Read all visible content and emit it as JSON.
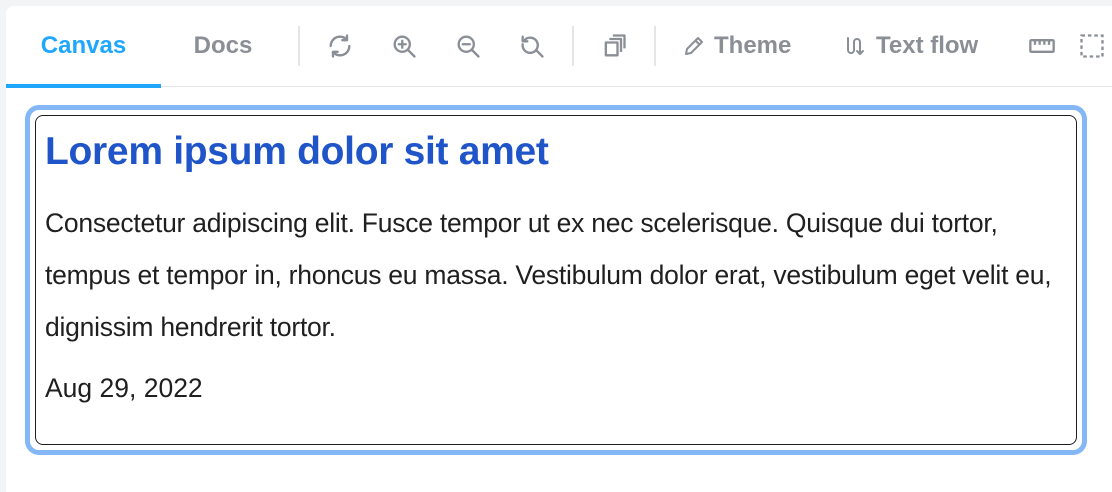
{
  "toolbar": {
    "tabs": [
      {
        "label": "Canvas",
        "active": true
      },
      {
        "label": "Docs",
        "active": false
      }
    ],
    "tools": {
      "remount": "remount-icon",
      "zoom_in": "zoom-in-icon",
      "zoom_out": "zoom-out-icon",
      "zoom_reset": "zoom-reset-icon",
      "backgrounds": "backgrounds-icon"
    },
    "theme_label": "Theme",
    "text_flow_label": "Text flow"
  },
  "card": {
    "title": "Lorem ipsum dolor sit amet",
    "body": "Consectetur adipiscing elit. Fusce tempor ut ex nec scelerisque. Quisque dui tortor, tempus et tempor in, rhoncus eu massa. Vestibulum dolor erat, vestibulum eget velit eu, dignissim hendrerit tortor.",
    "date": "Aug 29, 2022"
  },
  "colors": {
    "accent": "#1ea7fd",
    "title": "#1f55c9",
    "focus_ring": "#84b7f5",
    "toolbar_text": "#8a8f96"
  }
}
